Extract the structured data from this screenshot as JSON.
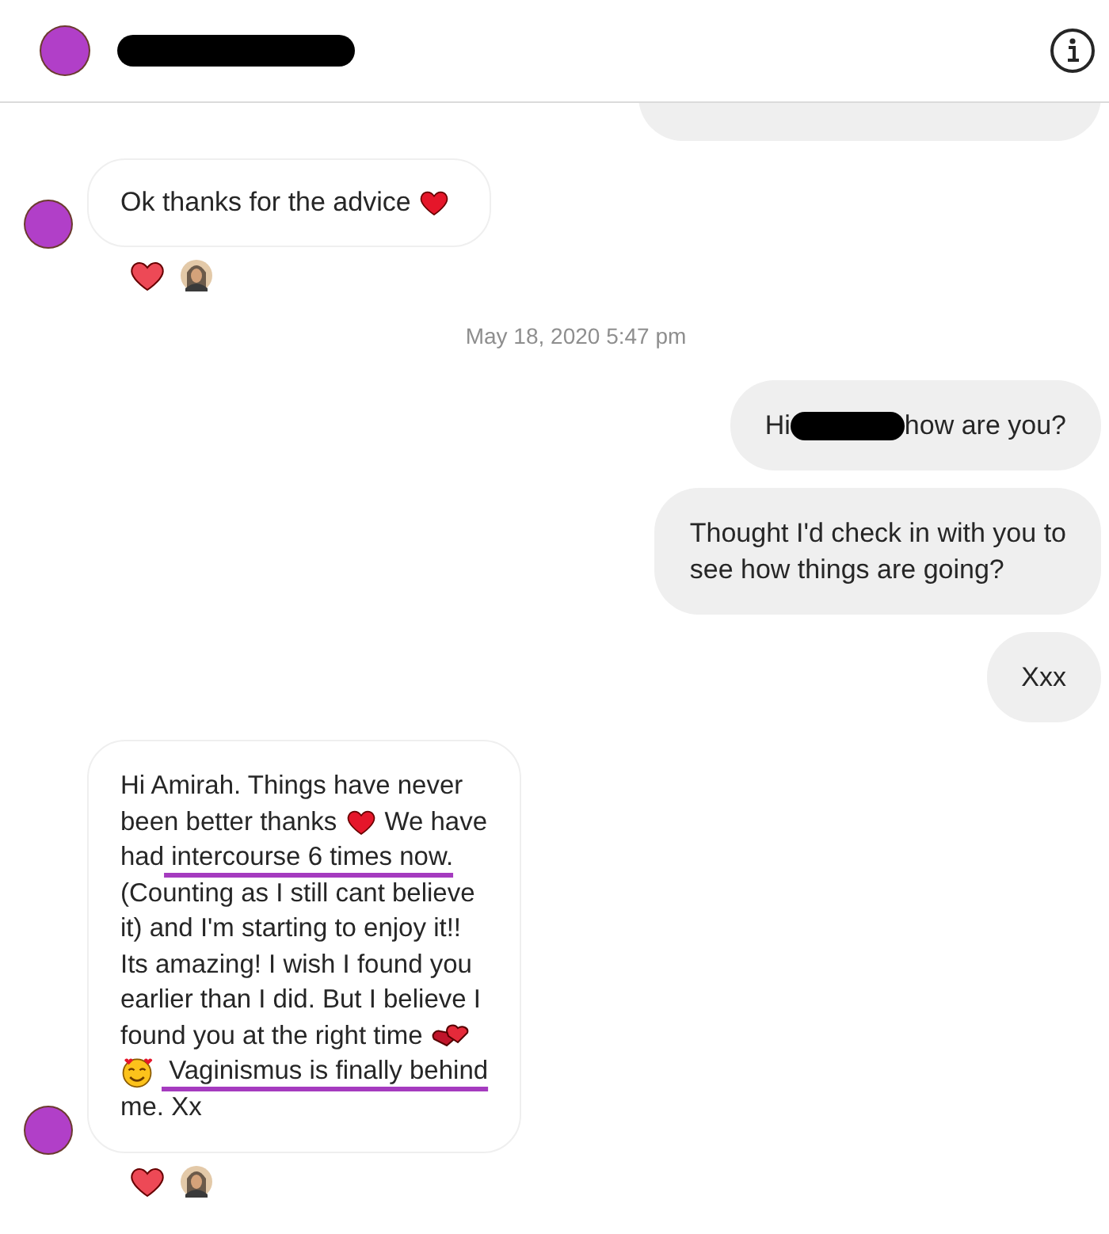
{
  "header": {
    "name_redacted": true
  },
  "messages": [
    {
      "kind": "outgoing_partial"
    },
    {
      "kind": "incoming",
      "avatar": true,
      "lines": [
        [
          {
            "kind": "text",
            "text": "Ok thanks for the advice"
          },
          {
            "kind": "heart-emoji"
          }
        ]
      ],
      "reactions": [
        {
          "kind": "heart"
        },
        {
          "kind": "avatar"
        }
      ]
    },
    {
      "kind": "timestamp",
      "text": "May 18, 2020 5:47 pm"
    },
    {
      "kind": "outgoing",
      "lines": [
        [
          {
            "kind": "text",
            "text": "Hi"
          },
          {
            "kind": "redaction"
          },
          {
            "kind": "text",
            "text": "how are you?"
          }
        ]
      ]
    },
    {
      "kind": "outgoing",
      "lines": [
        [
          {
            "kind": "text",
            "text": "Thought I'd check in with you to"
          }
        ],
        [
          {
            "kind": "text",
            "text": "see how things are going?"
          }
        ]
      ]
    },
    {
      "kind": "outgoing",
      "lines": [
        [
          {
            "kind": "text",
            "text": "Xxx"
          }
        ]
      ]
    },
    {
      "kind": "incoming",
      "avatar": true,
      "lines": [
        [
          {
            "kind": "text",
            "text": "Hi Amirah. Things have never"
          }
        ],
        [
          {
            "kind": "text",
            "text": "been better thanks"
          },
          {
            "kind": "heart-emoji"
          },
          {
            "kind": "text",
            "text": "We have"
          }
        ],
        [
          {
            "kind": "text",
            "text": "had"
          },
          {
            "kind": "text",
            "text": " intercourse 6 times now.",
            "underlined": true
          }
        ],
        [
          {
            "kind": "text",
            "text": "(Counting as I still cant believe"
          }
        ],
        [
          {
            "kind": "text",
            "text": "it) and I'm starting to enjoy it!!"
          }
        ],
        [
          {
            "kind": "text",
            "text": "Its amazing! I wish I found you"
          }
        ],
        [
          {
            "kind": "text",
            "text": "earlier than I did. But I believe I"
          }
        ],
        [
          {
            "kind": "text",
            "text": "found you at the right time"
          },
          {
            "kind": "twin-hearts-emoji"
          }
        ],
        [
          {
            "kind": "smiling-hearts-emoji"
          },
          {
            "kind": "text",
            "text": " Vaginismus is finally behind",
            "underlined": true
          }
        ],
        [
          {
            "kind": "text",
            "text": "me. Xx"
          }
        ]
      ],
      "reactions": [
        {
          "kind": "heart"
        },
        {
          "kind": "avatar"
        }
      ]
    }
  ]
}
